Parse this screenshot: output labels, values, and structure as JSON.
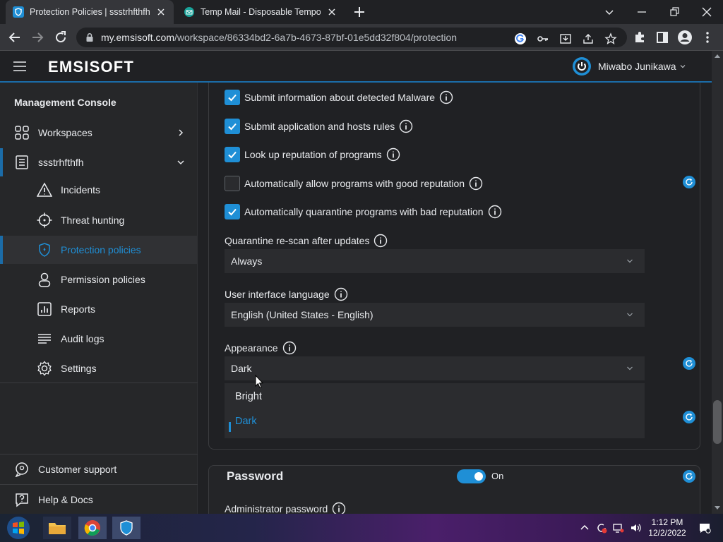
{
  "browser": {
    "tabs": [
      {
        "title": "Protection Policies | ssstrhfthfh | E",
        "active": true
      },
      {
        "title": "Temp Mail - Disposable Tempora",
        "active": false
      }
    ],
    "url_host": "my.emsisoft.com",
    "url_path": "/workspace/86334bd2-6a7b-4673-87bf-01e5dd32f804/protection"
  },
  "header": {
    "logo": "EMSISOFT",
    "user_name": "Miwabo Junikawa"
  },
  "sidebar": {
    "heading": "Management Console",
    "items": [
      {
        "label": "Workspaces",
        "icon": "grid-icon"
      },
      {
        "label": "ssstrhfthfh",
        "icon": "workspace-icon"
      },
      {
        "label": "Incidents",
        "icon": "warning-icon"
      },
      {
        "label": "Threat hunting",
        "icon": "crosshair-icon"
      },
      {
        "label": "Protection policies",
        "icon": "shield-icon"
      },
      {
        "label": "Permission policies",
        "icon": "user-icon"
      },
      {
        "label": "Reports",
        "icon": "report-icon"
      },
      {
        "label": "Audit logs",
        "icon": "list-icon"
      },
      {
        "label": "Settings",
        "icon": "gear-icon"
      }
    ],
    "footer": [
      {
        "label": "Customer support",
        "icon": "support-icon"
      },
      {
        "label": "Help & Docs",
        "icon": "help-icon"
      }
    ]
  },
  "settings": {
    "checkboxes": [
      {
        "label": "Submit information about detected Malware",
        "checked": true
      },
      {
        "label": "Submit application and hosts rules",
        "checked": true
      },
      {
        "label": "Look up reputation of programs",
        "checked": true
      },
      {
        "label": "Automatically allow programs with good reputation",
        "checked": false
      },
      {
        "label": "Automatically quarantine programs with bad reputation",
        "checked": true
      }
    ],
    "quarantine_label": "Quarantine re-scan after updates",
    "quarantine_value": "Always",
    "language_label": "User interface language",
    "language_value": "English (United States - English)",
    "appearance_label": "Appearance",
    "appearance_value": "Dark",
    "appearance_options": [
      "Bright",
      "Dark"
    ]
  },
  "password": {
    "title": "Password",
    "toggle_label": "On",
    "admin_label": "Administrator password"
  },
  "taskbar": {
    "time": "1:12 PM",
    "date": "12/2/2022"
  },
  "colors": {
    "accent": "#1f8fd6",
    "background": "#202124",
    "sidebar": "#262729"
  }
}
